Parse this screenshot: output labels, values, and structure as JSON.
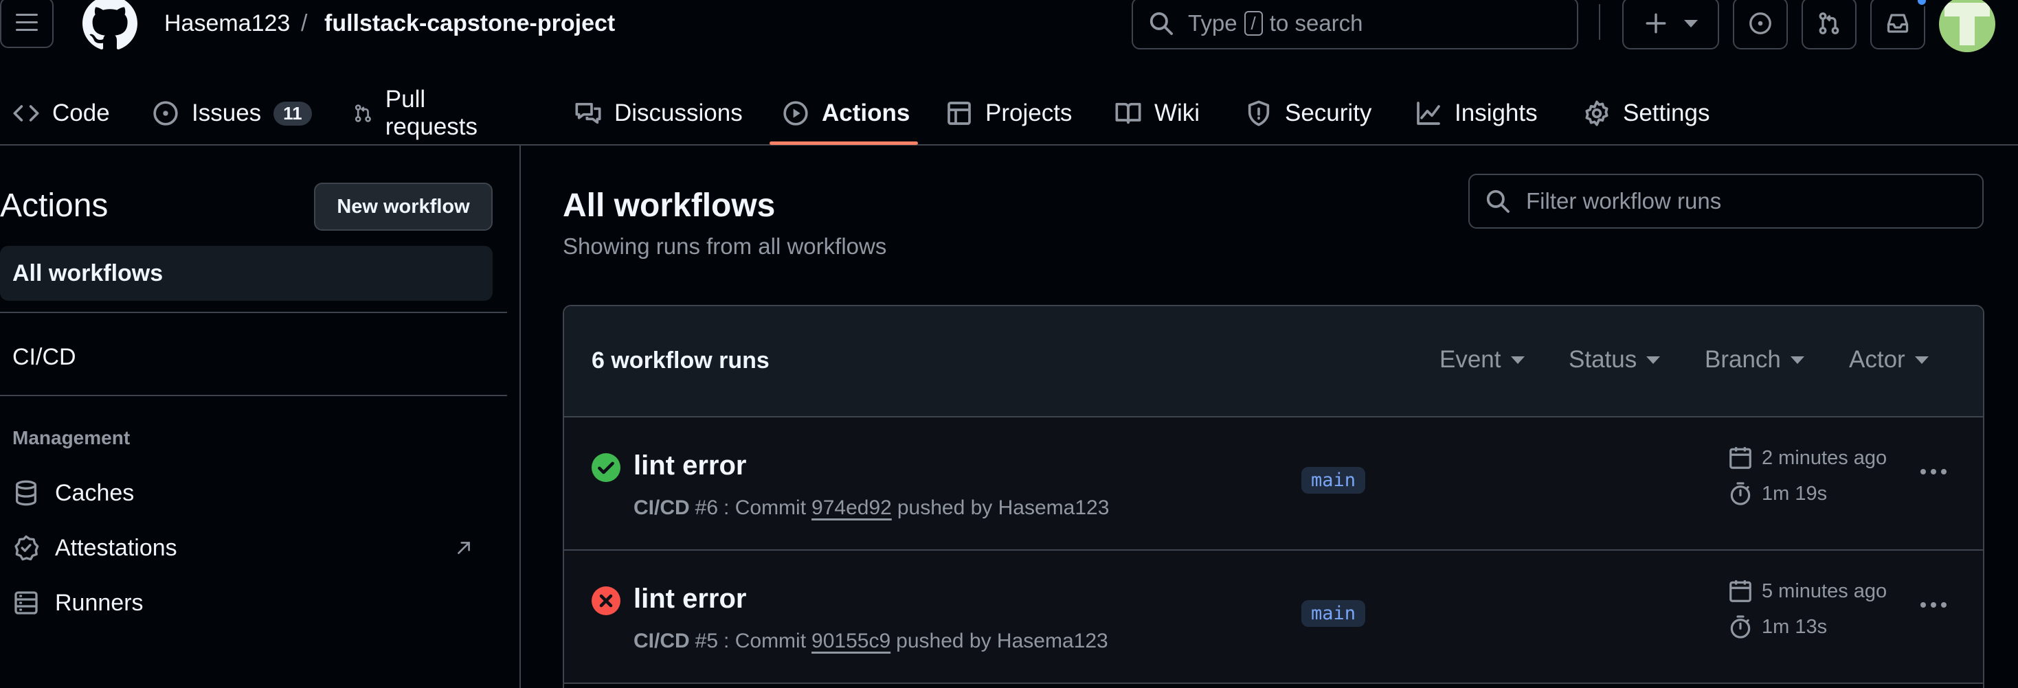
{
  "header": {
    "owner": "Hasema123",
    "separator": "/",
    "repo": "fullstack-capstone-project",
    "search": {
      "prefix": "Type",
      "key": "/",
      "suffix": "to search"
    }
  },
  "tabs": [
    {
      "label": "Code",
      "icon": "code-icon"
    },
    {
      "label": "Issues",
      "icon": "issue-opened-icon",
      "count": "11"
    },
    {
      "label": "Pull requests",
      "icon": "git-pull-request-icon"
    },
    {
      "label": "Discussions",
      "icon": "comment-discussion-icon"
    },
    {
      "label": "Actions",
      "icon": "play-icon",
      "active": true
    },
    {
      "label": "Projects",
      "icon": "table-icon"
    },
    {
      "label": "Wiki",
      "icon": "book-icon"
    },
    {
      "label": "Security",
      "icon": "shield-icon"
    },
    {
      "label": "Insights",
      "icon": "graph-icon"
    },
    {
      "label": "Settings",
      "icon": "gear-icon"
    }
  ],
  "sidebar": {
    "title": "Actions",
    "new_workflow": "New workflow",
    "all_workflows": "All workflows",
    "workflows": [
      "CI/CD"
    ],
    "management_heading": "Management",
    "management": [
      {
        "label": "Caches",
        "icon": "database-icon"
      },
      {
        "label": "Attestations",
        "icon": "verified-icon"
      },
      {
        "label": "Runners",
        "icon": "server-icon"
      }
    ]
  },
  "main": {
    "title": "All workflows",
    "subtitle": "Showing runs from all workflows",
    "filter_placeholder": "Filter workflow runs",
    "runs_count": "6 workflow runs",
    "filters": [
      "Event",
      "Status",
      "Branch",
      "Actor"
    ],
    "runs": [
      {
        "status": "success",
        "name": "lint error",
        "workflow": "CI/CD",
        "number": "#6",
        "sha": "974ed92",
        "pushed_by": "pushed by Hasema123",
        "branch": "main",
        "ago": "2 minutes ago",
        "duration": "1m 19s"
      },
      {
        "status": "failure",
        "name": "lint error",
        "workflow": "CI/CD",
        "number": "#5",
        "sha": "90155c9",
        "pushed_by": "pushed by Hasema123",
        "branch": "main",
        "ago": "5 minutes ago",
        "duration": "1m 13s"
      }
    ]
  },
  "colors": {
    "accent": "#f78166",
    "success": "#3fb950",
    "failure": "#f85149",
    "branch": "#7aa6f7"
  }
}
